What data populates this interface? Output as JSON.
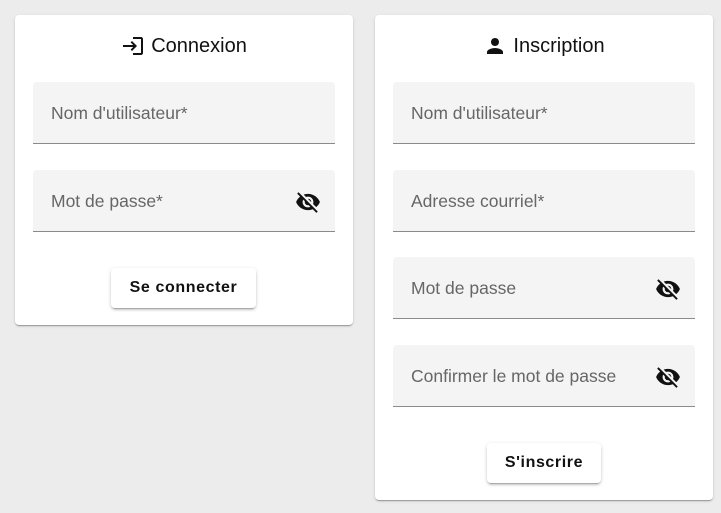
{
  "login": {
    "title": "Connexion",
    "title_icon": "login-icon",
    "username_label": "Nom d'utilisateur*",
    "password_label": "Mot de passe*",
    "submit_label": "Se connecter"
  },
  "register": {
    "title": "Inscription",
    "title_icon": "person-icon",
    "username_label": "Nom d'utilisateur*",
    "email_label": "Adresse courriel*",
    "password_label": "Mot de passe",
    "confirm_label": "Confirmer le mot de passe",
    "submit_label": "S'inscrire"
  },
  "icons": {
    "password_toggle": "visibility-off-icon"
  },
  "colors": {
    "background": "#ececec",
    "card": "#ffffff",
    "field": "#f4f4f4",
    "label": "#666666"
  }
}
